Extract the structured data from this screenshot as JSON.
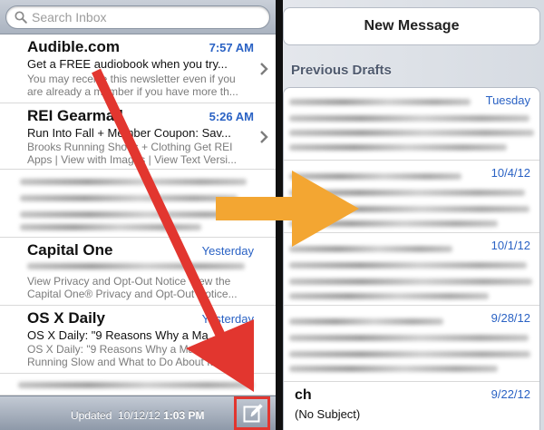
{
  "search": {
    "placeholder": "Search Inbox"
  },
  "inbox": {
    "messages": [
      {
        "sender": "Audible.com",
        "time": "7:57 AM",
        "subject": "Get a FREE audiobook when you try...",
        "preview_line1": "You may receive this newsletter even if you",
        "preview_line2": "are already a member if you have more th..."
      },
      {
        "sender": "REI Gearmail",
        "time": "5:26 AM",
        "subject": "Run Into Fall + Member Coupon: Sav...",
        "preview_line1": "Brooks Running Shoes + Clothing Get REI",
        "preview_line2": "Apps | View with Images | View Text Versi..."
      },
      {
        "sender": "Capital One",
        "time": "Yesterday",
        "preview_line1": "View Privacy and Opt-Out Notice View the",
        "preview_line2": "Capital One® Privacy and Opt-Out Notice..."
      },
      {
        "sender": "OS X Daily",
        "time": "Yesterday",
        "subject": "OS X Daily: \"9 Reasons Why a Ma...",
        "preview_line1": "OS X Daily: \"9 Reasons Why a Mac is",
        "preview_line2": "Running Slow and What to Do About It\"..."
      }
    ]
  },
  "status": {
    "updated_label": "Updated",
    "date": "10/12/12",
    "time": "1:03 PM"
  },
  "right_panel": {
    "new_message_label": "New Message",
    "previous_drafts_label": "Previous Drafts",
    "drafts": [
      {
        "date": "Tuesday"
      },
      {
        "date": "10/4/12"
      },
      {
        "date": "10/1/12"
      },
      {
        "date": "9/28/12"
      },
      {
        "date": "9/22/12",
        "title": "ch",
        "subject": "(No Subject)"
      }
    ]
  },
  "colors": {
    "accent_blue": "#2a62c4",
    "annotation_red": "#e2362f",
    "annotation_orange": "#f3a632"
  },
  "icons": {
    "search": "magnifier-icon",
    "chevron": "chevron-right-icon",
    "compose": "compose-icon"
  }
}
